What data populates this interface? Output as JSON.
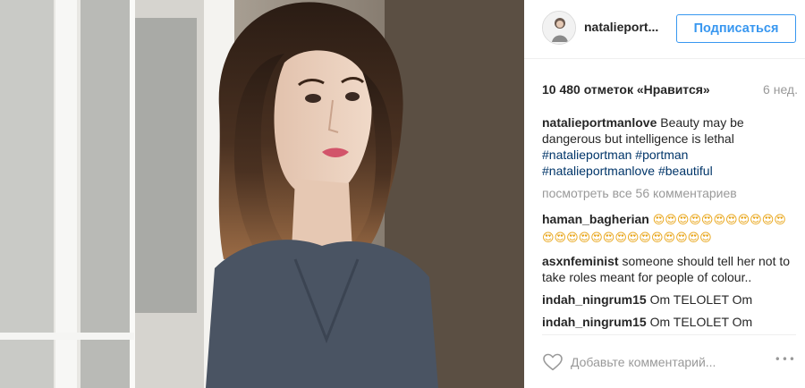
{
  "post": {
    "author": "natalieport...",
    "follow_label": "Подписаться",
    "likes": "10 480 отметок «Нравится»",
    "time_ago": "6 нед."
  },
  "comments": [
    {
      "user": "natalieportmanlove",
      "text": "Beauty may be dangerous but intelligence is lethal",
      "tags": [
        "#natalieportman",
        "#portman",
        "#natalieportmanlove",
        "#beautiful"
      ]
    },
    {
      "user": "haman_bagherian",
      "text": "😍😍😍😍😍😍😍😍😍😍😍😍😍😍😍😍😍😍😍😍😍😍😍😍😍"
    },
    {
      "user": "asxnfeminist",
      "text": "someone should tell her not to take roles meant for people of colour.."
    },
    {
      "user": "indah_ningrum15",
      "text": "Om TELOLET Om"
    },
    {
      "user": "indah_ningrum15",
      "text": "Om TELOLET Om"
    }
  ],
  "view_all_label": "посмотреть все 56 комментариев",
  "add_comment_placeholder": "Добавьте комментарий...",
  "more_label": "•••",
  "icons": {
    "like": "heart-outline-icon",
    "more": "more-dots-icon"
  },
  "colors": {
    "link": "#003569",
    "accent": "#3897f0",
    "muted": "#999999"
  }
}
